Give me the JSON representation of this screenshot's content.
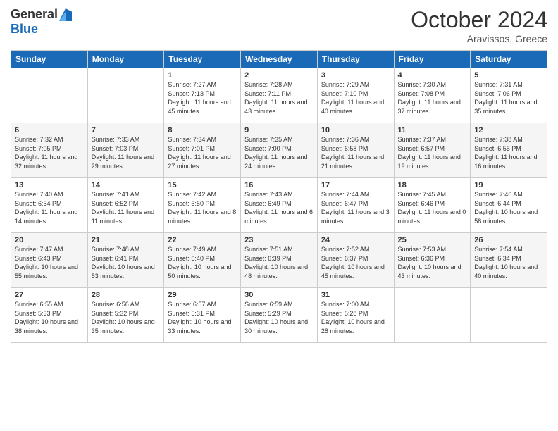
{
  "logo": {
    "general": "General",
    "blue": "Blue"
  },
  "title": "October 2024",
  "location": "Aravissos, Greece",
  "weekdays": [
    "Sunday",
    "Monday",
    "Tuesday",
    "Wednesday",
    "Thursday",
    "Friday",
    "Saturday"
  ],
  "weeks": [
    [
      {
        "day": "",
        "sunrise": "",
        "sunset": "",
        "daylight": ""
      },
      {
        "day": "",
        "sunrise": "",
        "sunset": "",
        "daylight": ""
      },
      {
        "day": "1",
        "sunrise": "Sunrise: 7:27 AM",
        "sunset": "Sunset: 7:13 PM",
        "daylight": "Daylight: 11 hours and 45 minutes."
      },
      {
        "day": "2",
        "sunrise": "Sunrise: 7:28 AM",
        "sunset": "Sunset: 7:11 PM",
        "daylight": "Daylight: 11 hours and 43 minutes."
      },
      {
        "day": "3",
        "sunrise": "Sunrise: 7:29 AM",
        "sunset": "Sunset: 7:10 PM",
        "daylight": "Daylight: 11 hours and 40 minutes."
      },
      {
        "day": "4",
        "sunrise": "Sunrise: 7:30 AM",
        "sunset": "Sunset: 7:08 PM",
        "daylight": "Daylight: 11 hours and 37 minutes."
      },
      {
        "day": "5",
        "sunrise": "Sunrise: 7:31 AM",
        "sunset": "Sunset: 7:06 PM",
        "daylight": "Daylight: 11 hours and 35 minutes."
      }
    ],
    [
      {
        "day": "6",
        "sunrise": "Sunrise: 7:32 AM",
        "sunset": "Sunset: 7:05 PM",
        "daylight": "Daylight: 11 hours and 32 minutes."
      },
      {
        "day": "7",
        "sunrise": "Sunrise: 7:33 AM",
        "sunset": "Sunset: 7:03 PM",
        "daylight": "Daylight: 11 hours and 29 minutes."
      },
      {
        "day": "8",
        "sunrise": "Sunrise: 7:34 AM",
        "sunset": "Sunset: 7:01 PM",
        "daylight": "Daylight: 11 hours and 27 minutes."
      },
      {
        "day": "9",
        "sunrise": "Sunrise: 7:35 AM",
        "sunset": "Sunset: 7:00 PM",
        "daylight": "Daylight: 11 hours and 24 minutes."
      },
      {
        "day": "10",
        "sunrise": "Sunrise: 7:36 AM",
        "sunset": "Sunset: 6:58 PM",
        "daylight": "Daylight: 11 hours and 21 minutes."
      },
      {
        "day": "11",
        "sunrise": "Sunrise: 7:37 AM",
        "sunset": "Sunset: 6:57 PM",
        "daylight": "Daylight: 11 hours and 19 minutes."
      },
      {
        "day": "12",
        "sunrise": "Sunrise: 7:38 AM",
        "sunset": "Sunset: 6:55 PM",
        "daylight": "Daylight: 11 hours and 16 minutes."
      }
    ],
    [
      {
        "day": "13",
        "sunrise": "Sunrise: 7:40 AM",
        "sunset": "Sunset: 6:54 PM",
        "daylight": "Daylight: 11 hours and 14 minutes."
      },
      {
        "day": "14",
        "sunrise": "Sunrise: 7:41 AM",
        "sunset": "Sunset: 6:52 PM",
        "daylight": "Daylight: 11 hours and 11 minutes."
      },
      {
        "day": "15",
        "sunrise": "Sunrise: 7:42 AM",
        "sunset": "Sunset: 6:50 PM",
        "daylight": "Daylight: 11 hours and 8 minutes."
      },
      {
        "day": "16",
        "sunrise": "Sunrise: 7:43 AM",
        "sunset": "Sunset: 6:49 PM",
        "daylight": "Daylight: 11 hours and 6 minutes."
      },
      {
        "day": "17",
        "sunrise": "Sunrise: 7:44 AM",
        "sunset": "Sunset: 6:47 PM",
        "daylight": "Daylight: 11 hours and 3 minutes."
      },
      {
        "day": "18",
        "sunrise": "Sunrise: 7:45 AM",
        "sunset": "Sunset: 6:46 PM",
        "daylight": "Daylight: 11 hours and 0 minutes."
      },
      {
        "day": "19",
        "sunrise": "Sunrise: 7:46 AM",
        "sunset": "Sunset: 6:44 PM",
        "daylight": "Daylight: 10 hours and 58 minutes."
      }
    ],
    [
      {
        "day": "20",
        "sunrise": "Sunrise: 7:47 AM",
        "sunset": "Sunset: 6:43 PM",
        "daylight": "Daylight: 10 hours and 55 minutes."
      },
      {
        "day": "21",
        "sunrise": "Sunrise: 7:48 AM",
        "sunset": "Sunset: 6:41 PM",
        "daylight": "Daylight: 10 hours and 53 minutes."
      },
      {
        "day": "22",
        "sunrise": "Sunrise: 7:49 AM",
        "sunset": "Sunset: 6:40 PM",
        "daylight": "Daylight: 10 hours and 50 minutes."
      },
      {
        "day": "23",
        "sunrise": "Sunrise: 7:51 AM",
        "sunset": "Sunset: 6:39 PM",
        "daylight": "Daylight: 10 hours and 48 minutes."
      },
      {
        "day": "24",
        "sunrise": "Sunrise: 7:52 AM",
        "sunset": "Sunset: 6:37 PM",
        "daylight": "Daylight: 10 hours and 45 minutes."
      },
      {
        "day": "25",
        "sunrise": "Sunrise: 7:53 AM",
        "sunset": "Sunset: 6:36 PM",
        "daylight": "Daylight: 10 hours and 43 minutes."
      },
      {
        "day": "26",
        "sunrise": "Sunrise: 7:54 AM",
        "sunset": "Sunset: 6:34 PM",
        "daylight": "Daylight: 10 hours and 40 minutes."
      }
    ],
    [
      {
        "day": "27",
        "sunrise": "Sunrise: 6:55 AM",
        "sunset": "Sunset: 5:33 PM",
        "daylight": "Daylight: 10 hours and 38 minutes."
      },
      {
        "day": "28",
        "sunrise": "Sunrise: 6:56 AM",
        "sunset": "Sunset: 5:32 PM",
        "daylight": "Daylight: 10 hours and 35 minutes."
      },
      {
        "day": "29",
        "sunrise": "Sunrise: 6:57 AM",
        "sunset": "Sunset: 5:31 PM",
        "daylight": "Daylight: 10 hours and 33 minutes."
      },
      {
        "day": "30",
        "sunrise": "Sunrise: 6:59 AM",
        "sunset": "Sunset: 5:29 PM",
        "daylight": "Daylight: 10 hours and 30 minutes."
      },
      {
        "day": "31",
        "sunrise": "Sunrise: 7:00 AM",
        "sunset": "Sunset: 5:28 PM",
        "daylight": "Daylight: 10 hours and 28 minutes."
      },
      {
        "day": "",
        "sunrise": "",
        "sunset": "",
        "daylight": ""
      },
      {
        "day": "",
        "sunrise": "",
        "sunset": "",
        "daylight": ""
      }
    ]
  ]
}
